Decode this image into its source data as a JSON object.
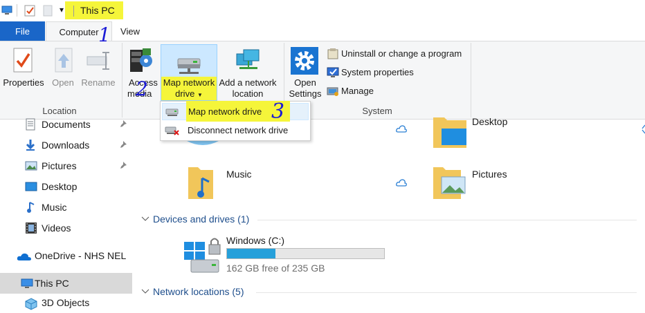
{
  "window": {
    "title": "This PC",
    "qat_dropdown_glyph": "▾"
  },
  "tabs": {
    "file": "File",
    "computer": "Computer",
    "view": "View"
  },
  "ribbon": {
    "location_group": {
      "label": "Location",
      "properties": "Properties",
      "open": "Open",
      "rename": "Rename"
    },
    "network_group": {
      "access_media_line1": "Access",
      "access_media_line2": "media",
      "map_network_drive_line1": "Map network",
      "map_network_drive_line2": "drive",
      "add_network_location_line1": "Add a network",
      "add_network_location_line2": "location"
    },
    "system_group": {
      "label": "System",
      "open_settings_line1": "Open",
      "open_settings_line2": "Settings",
      "uninstall": "Uninstall or change a program",
      "system_properties": "System properties",
      "manage": "Manage"
    }
  },
  "dropdown_menu": {
    "items": [
      "Map network drive",
      "Disconnect network drive"
    ]
  },
  "annotations": [
    "1",
    "2",
    "3"
  ],
  "nav_pane": {
    "items": [
      {
        "label": "Documents",
        "pinned": true,
        "icon": "documents-icon"
      },
      {
        "label": "Downloads",
        "pinned": true,
        "icon": "downloads-icon"
      },
      {
        "label": "Pictures",
        "pinned": true,
        "icon": "pictures-icon"
      },
      {
        "label": "Desktop",
        "pinned": false,
        "icon": "desktop-icon"
      },
      {
        "label": "Music",
        "pinned": false,
        "icon": "music-icon"
      },
      {
        "label": "Videos",
        "pinned": false,
        "icon": "videos-icon"
      },
      {
        "label": "OneDrive - NHS NEL",
        "pinned": false,
        "icon": "onedrive-icon"
      },
      {
        "label": "This PC",
        "pinned": false,
        "icon": "this-pc-icon",
        "selected": true
      },
      {
        "label": "3D Objects",
        "pinned": false,
        "icon": "3d-objects-icon"
      }
    ]
  },
  "content": {
    "folders": [
      {
        "label": "Desktop"
      },
      {
        "label": "Music"
      },
      {
        "label": "Pictures"
      }
    ],
    "devices_header": "Devices and drives (1)",
    "drive": {
      "name": "Windows (C:)",
      "free_text": "162 GB free of 235 GB",
      "used_fraction": 0.31
    },
    "network_header": "Network locations (5)"
  },
  "colors": {
    "accent": "#1a66c8",
    "highlight": "#f5f53a",
    "section_header": "#1e4e8c",
    "drive_bar": "#26a0da",
    "annotation_ink": "#1b1bd6"
  }
}
